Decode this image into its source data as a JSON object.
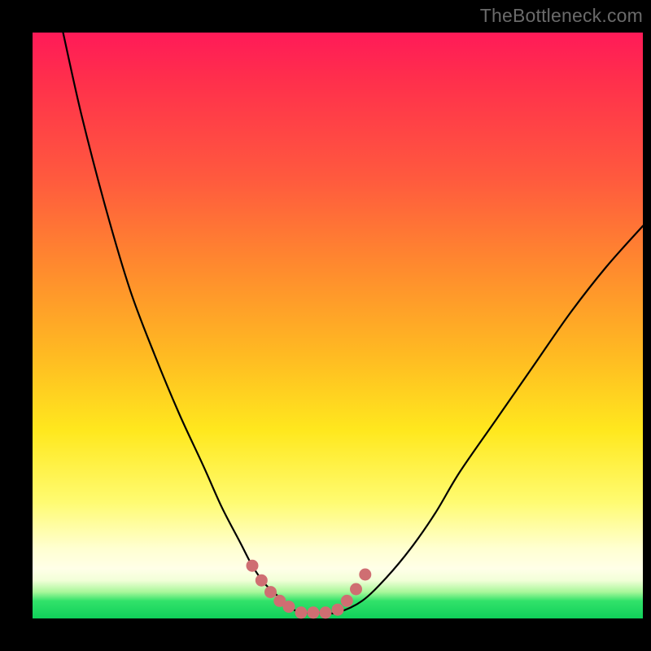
{
  "watermark": "TheBottleneck.com",
  "colors": {
    "frame": "#000000",
    "marker": "#cf6e72",
    "curve": "#000000",
    "gradient_top": "#ff1a58",
    "gradient_bottom": "#10d05a"
  },
  "chart_data": {
    "type": "line",
    "title": "",
    "xlabel": "",
    "ylabel": "",
    "xlim": [
      0,
      100
    ],
    "ylim": [
      0,
      100
    ],
    "series": [
      {
        "name": "curve",
        "x": [
          5,
          8,
          12,
          16,
          20,
          24,
          28,
          31,
          34,
          36,
          38,
          40,
          42,
          44,
          46,
          48,
          50,
          54,
          58,
          62,
          66,
          70,
          76,
          82,
          88,
          94,
          100
        ],
        "y": [
          100,
          86,
          70,
          56,
          45,
          35,
          26,
          19,
          13,
          9,
          6,
          4,
          2,
          1,
          1,
          1,
          1,
          3,
          7,
          12,
          18,
          25,
          34,
          43,
          52,
          60,
          67
        ]
      }
    ],
    "markers": {
      "name": "highlighted-points",
      "x": [
        36,
        37.5,
        39,
        40.5,
        42,
        44,
        46,
        48,
        50,
        51.5,
        53,
        54.5
      ],
      "y": [
        9,
        6.5,
        4.5,
        3,
        2,
        1,
        1,
        1,
        1.5,
        3,
        5,
        7.5
      ]
    }
  }
}
